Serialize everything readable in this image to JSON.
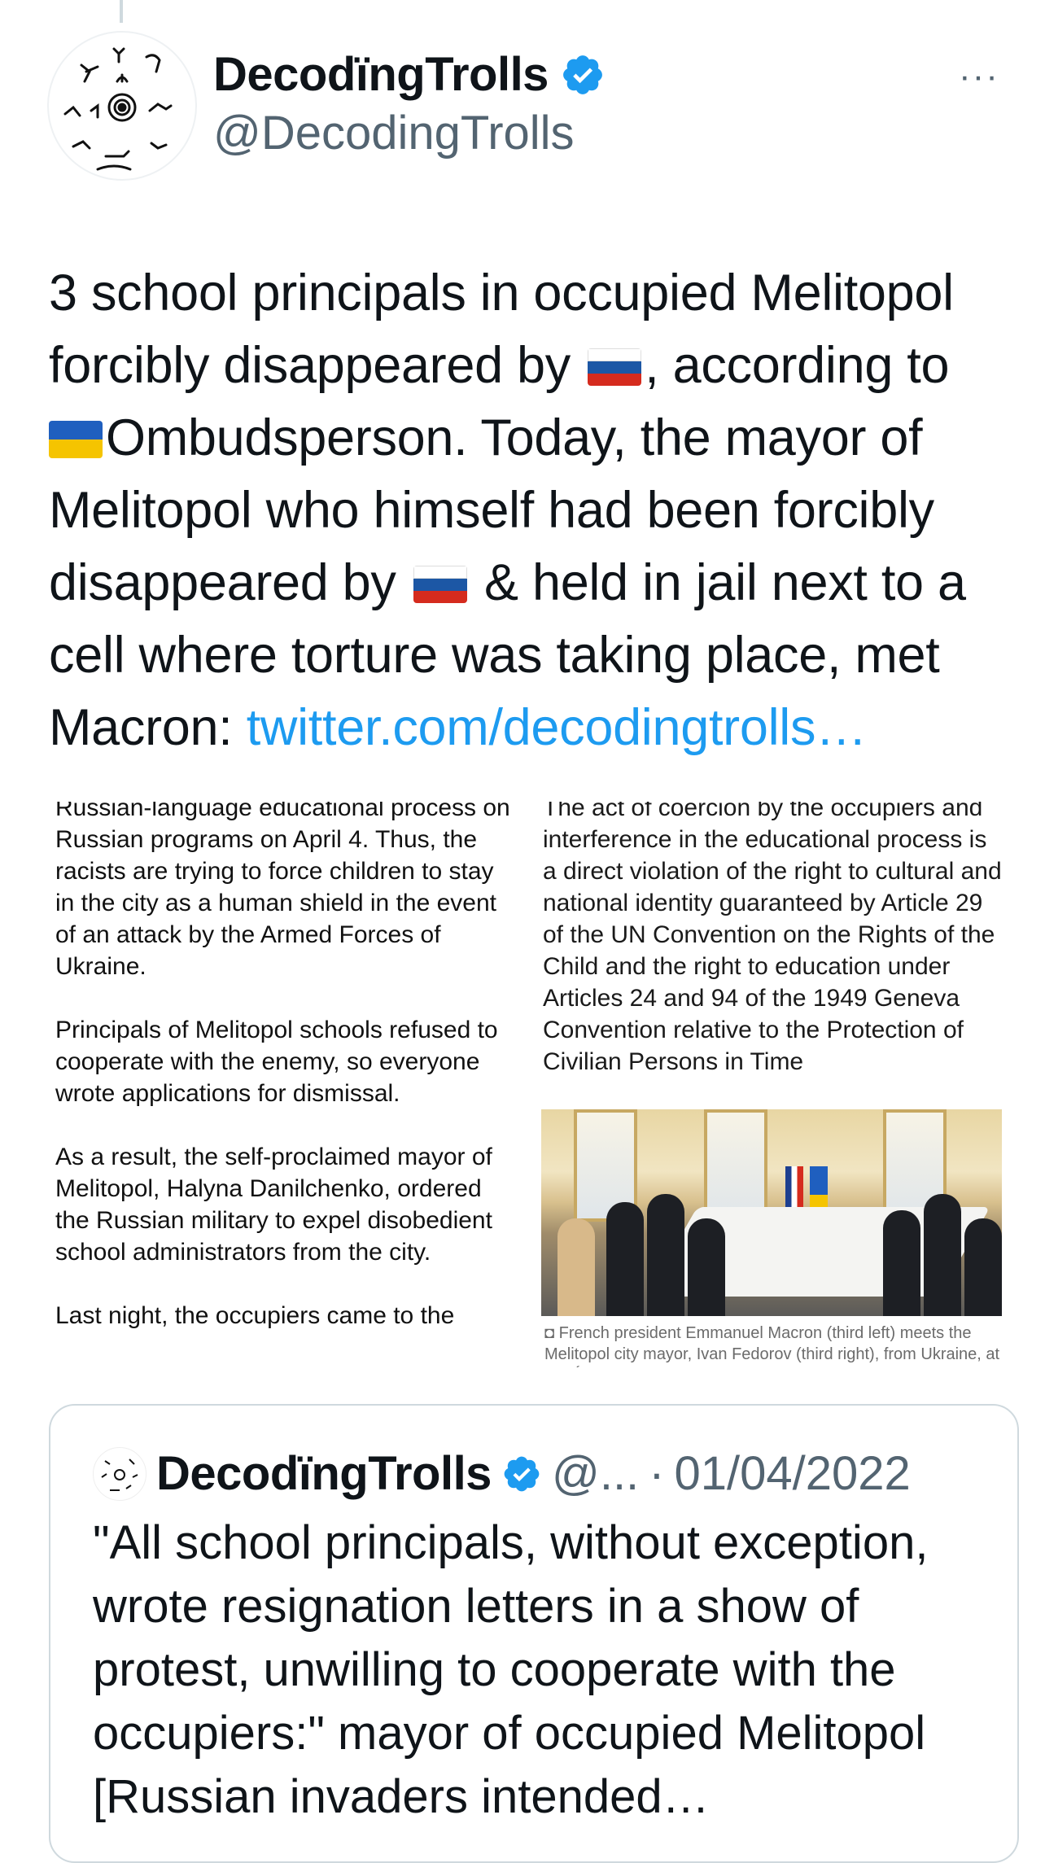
{
  "author": {
    "display_name": "DecodïngTrolls",
    "handle": "@DecodingTrolls",
    "verified": true,
    "avatar_icon": "petroglyph-symbols-avatar"
  },
  "more_label": "···",
  "tweet": {
    "line1": "3 school principals in occupied Melitopol",
    "line2a": "forcibly disappeared by ",
    "line2b": ", according to",
    "line3": "Ombudsperson. Today, the mayor of",
    "line4": "Melitopol who himself had been forcibly",
    "line5a": "disappeared by ",
    "line5b": " & held in jail next to a",
    "line6": "cell where torture was taking place, met",
    "line7": "Macron: ",
    "link": "twitter.com/decodingtrolls…"
  },
  "media": {
    "left_paragraphs": [
      "Russian-language educational process on Russian programs on April 4.  Thus, the racists are trying to force children to stay in the city as a human shield in the event of an attack by the Armed Forces of Ukraine.",
      "Principals of Melitopol schools refused to cooperate with the enemy, so everyone wrote applications for dismissal.",
      "As a result, the self-proclaimed mayor of Melitopol, Halyna Danilchenko, ordered the Russian military to expel disobedient school administrators from the city.",
      "Last night, the occupiers came to the"
    ],
    "right_text": "The act of coercion by the occupiers and interference in the educational process is a direct violation of the right to cultural and national identity guaranteed by Article 29 of the UN Convention on the Rights of the Child and the right to education under Articles 24 and 94 of the 1949 Geneva Convention relative to the Protection of Civilian Persons in Time",
    "caption": "French president Emmanuel Macron (third left) meets the Melitopol city mayor, Ivan Fedorov (third right), from Ukraine, at the Élysée Palace in Paris, on Friday. Photograph: Yoan"
  },
  "quoted": {
    "display_name": "DecodïngTrolls",
    "handle": "@...",
    "separator": "·",
    "date": "01/04/2022",
    "text": "\"All school principals, without exception, wrote resignation letters in a show of protest, unwilling to cooperate with the occupiers:\" mayor of occupied Melitopol [Russian invaders intended…"
  },
  "colors": {
    "link": "#1d9bf0",
    "verified": "#1d9bf0",
    "secondary_text": "#536471"
  }
}
